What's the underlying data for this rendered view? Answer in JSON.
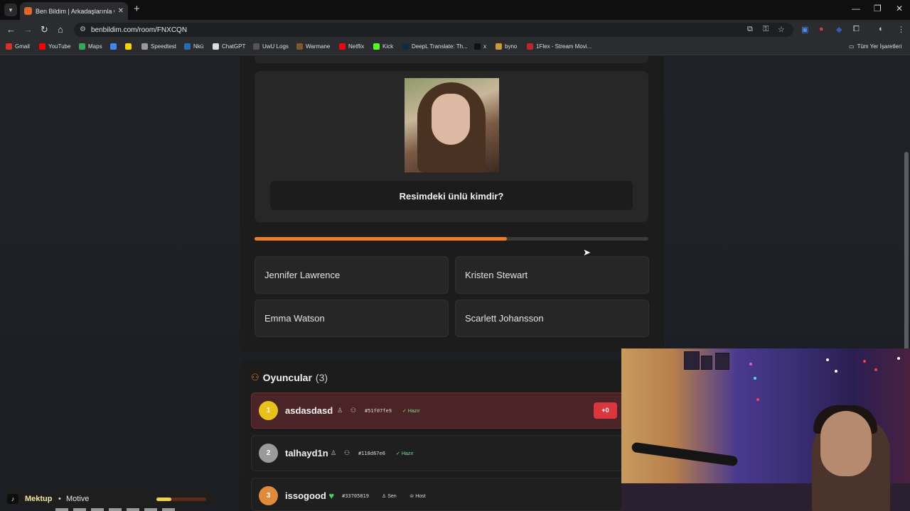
{
  "browser": {
    "tab_title": "Ben Bildim | Arkadaşlarınla Onli...",
    "url": "benbildim.com/room/FNXCQN",
    "bookmarks": [
      {
        "label": "Gmail",
        "color": "#d93025"
      },
      {
        "label": "YouTube",
        "color": "#ff0000"
      },
      {
        "label": "Maps",
        "color": "#34a853"
      },
      {
        "label": "",
        "color": "#4285f4"
      },
      {
        "label": "",
        "color": "#f5d400"
      },
      {
        "label": "Speedtest",
        "color": "#9a9a9a"
      },
      {
        "label": "Nkü",
        "color": "#2a6ab0"
      },
      {
        "label": "ChatGPT",
        "color": "#dcdcdc"
      },
      {
        "label": "UwU Logs",
        "color": "#555555"
      },
      {
        "label": "Warmane",
        "color": "#7a5a2a"
      },
      {
        "label": "Netflix",
        "color": "#e50914"
      },
      {
        "label": "Kick",
        "color": "#53fc18"
      },
      {
        "label": "DeepL Translate: Th...",
        "color": "#0f2b46"
      },
      {
        "label": "x",
        "color": "#111111"
      },
      {
        "label": "byno",
        "color": "#c89a3a"
      },
      {
        "label": "1Flex - Stream Movi...",
        "color": "#c0252e"
      }
    ],
    "all_bookmarks_label": "Tüm Yer İşaretleri"
  },
  "quiz": {
    "question": "Resimdeki ünlü kimdir?",
    "progress_percent": 64,
    "answers": [
      "Jennifer Lawrence",
      "Kristen Stewart",
      "Emma Watson",
      "Scarlett Johansson"
    ]
  },
  "players": {
    "title": "Oyuncular",
    "count": "(3)",
    "list": [
      {
        "rank": "1",
        "name": "asdasdasd",
        "id": "#51f07fe9",
        "status": "Hazır",
        "score": "+0"
      },
      {
        "rank": "2",
        "name": "talhayd1n",
        "id": "#118d67e6",
        "status": "Hazır"
      },
      {
        "rank": "3",
        "name": "issogood",
        "id": "#33705819",
        "status": "Sen",
        "extra": "Host"
      }
    ]
  },
  "music": {
    "title": "Mektup",
    "separator": "•",
    "artist": "Motive",
    "progress_percent": 30
  },
  "colors": {
    "accent": "#ef7a2a",
    "leader_row": "#4a2426",
    "score_badge": "#d9363e",
    "ready": "#7fe08a"
  }
}
